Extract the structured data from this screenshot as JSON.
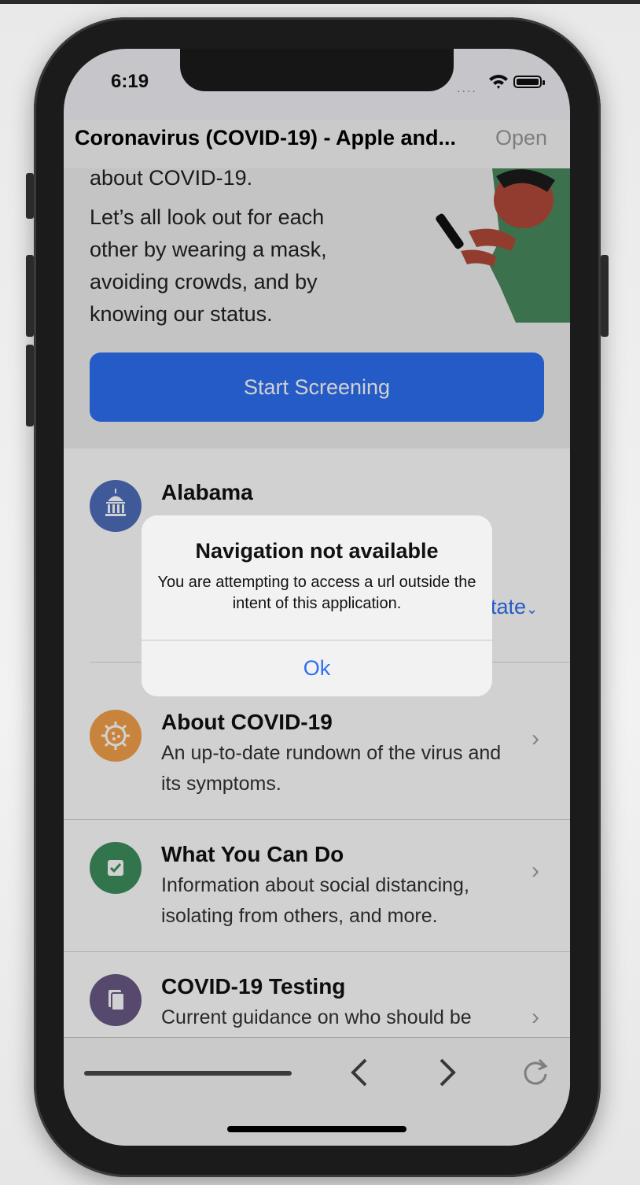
{
  "status_bar": {
    "time": "6:19",
    "signal": "...."
  },
  "header": {
    "title": "Coronavirus (COVID-19) - Apple and...",
    "open_label": "Open"
  },
  "hero": {
    "text_top": "about COVID-19.",
    "text_main": "Let’s all look out for each other by wearing a mask, avoiding crowds, and by knowing our status.",
    "start_button": "Start Screening"
  },
  "state_row": {
    "title": "Alabama",
    "partial_link": "tate"
  },
  "rows": [
    {
      "title": "About COVID-19",
      "desc": "An up-to-date rundown of the virus and its symptoms.",
      "icon": "virus-icon",
      "color": "#f5a04a"
    },
    {
      "title": "What You Can Do",
      "desc": "Information about social distancing, isolating from others, and more.",
      "icon": "checkbox-icon",
      "color": "#3d8f5e"
    },
    {
      "title": "COVID-19 Testing",
      "desc": "Current guidance on who should be",
      "icon": "clipboard-icon",
      "color": "#6a5a86"
    }
  ],
  "alert": {
    "title": "Navigation not available",
    "message": "You are attempting to access a url outside the intent of this application.",
    "ok": "Ok"
  },
  "colors": {
    "accent": "#2e6ff2",
    "state_icon": "#4f6dbb"
  }
}
